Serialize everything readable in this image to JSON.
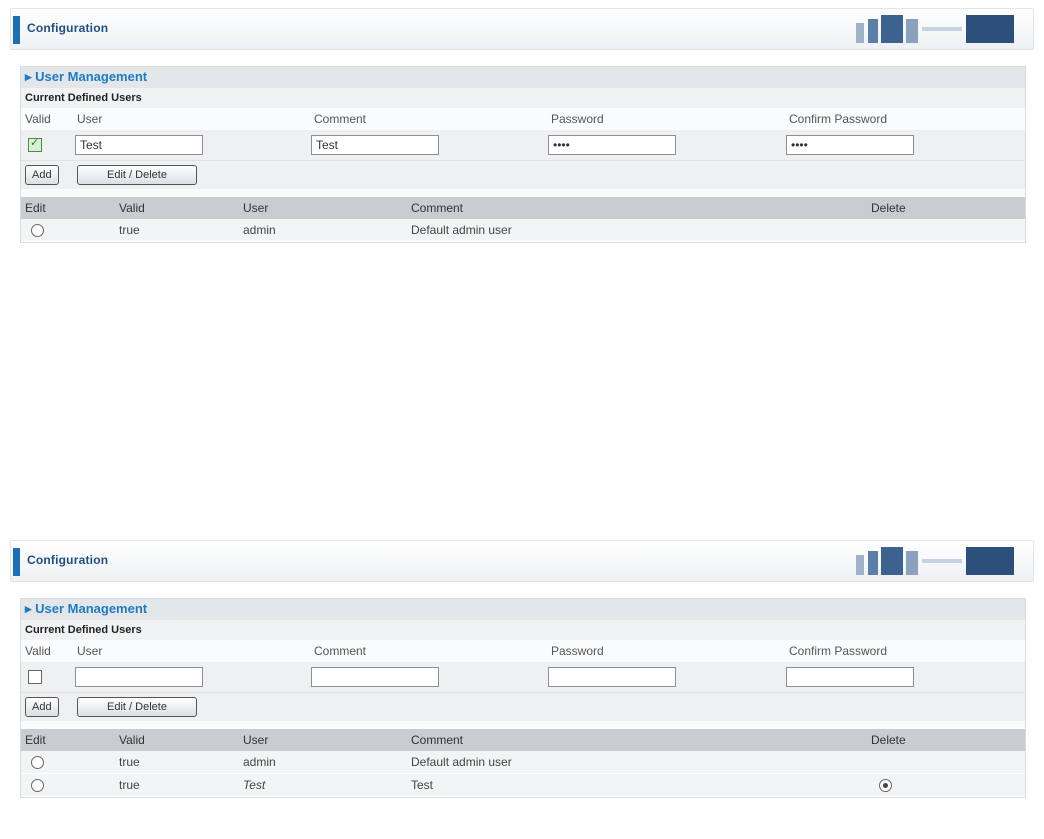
{
  "panels": [
    {
      "header_title": "Configuration",
      "section_title": "User Management",
      "subsection_title": "Current Defined Users",
      "form_headers": {
        "valid": "Valid",
        "user": "User",
        "comment": "Comment",
        "password": "Password",
        "confirm_password": "Confirm Password"
      },
      "form_values": {
        "valid_checked": true,
        "user": "Test",
        "comment": "Test",
        "password": "••••",
        "confirm_password": "••••"
      },
      "buttons": {
        "add": "Add",
        "edit_delete": "Edit / Delete"
      },
      "table_headers": {
        "edit": "Edit",
        "valid": "Valid",
        "user": "User",
        "comment": "Comment",
        "delete": "Delete"
      },
      "rows": [
        {
          "valid": "true",
          "user": "admin",
          "comment": "Default admin user",
          "has_delete": false
        }
      ]
    },
    {
      "header_title": "Configuration",
      "section_title": "User Management",
      "subsection_title": "Current Defined Users",
      "form_headers": {
        "valid": "Valid",
        "user": "User",
        "comment": "Comment",
        "password": "Password",
        "confirm_password": "Confirm Password"
      },
      "form_values": {
        "valid_checked": false,
        "user": "",
        "comment": "",
        "password": "",
        "confirm_password": ""
      },
      "buttons": {
        "add": "Add",
        "edit_delete": "Edit / Delete"
      },
      "table_headers": {
        "edit": "Edit",
        "valid": "Valid",
        "user": "User",
        "comment": "Comment",
        "delete": "Delete"
      },
      "rows": [
        {
          "valid": "true",
          "user": "admin",
          "comment": "Default admin user",
          "has_delete": false
        },
        {
          "valid": "true",
          "user": "Test",
          "comment": "Test",
          "has_delete": true
        }
      ]
    }
  ],
  "colors": {
    "accent": "#1d6fb3",
    "section_title": "#1f7bc3",
    "table_header": "#c9ccd0"
  },
  "icons": [
    "logo-graphic-icon",
    "bullet-arrow-icon",
    "radio-icon",
    "delete-radio-icon",
    "checkbox-icon"
  ]
}
